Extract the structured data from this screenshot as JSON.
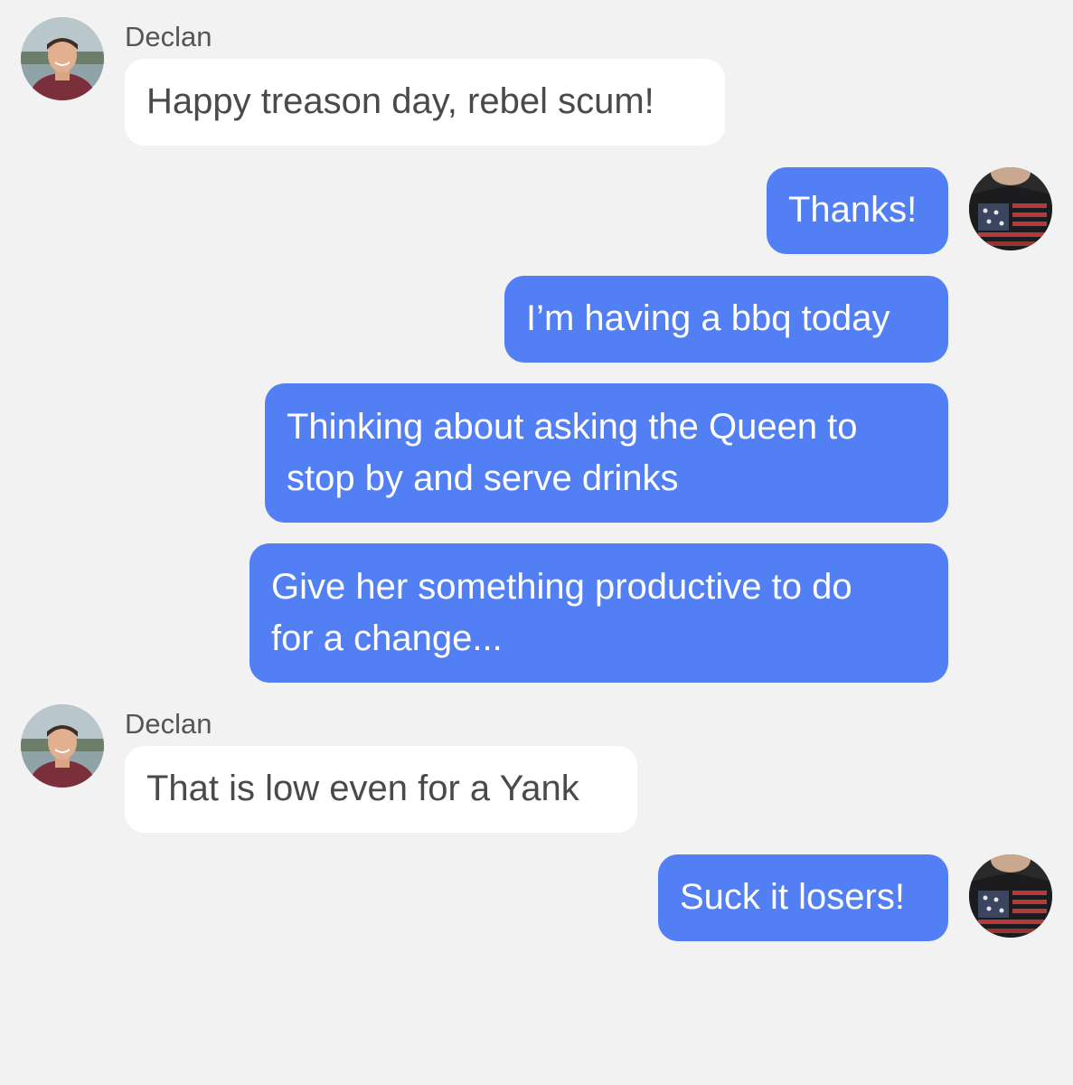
{
  "contact": {
    "name": "Declan",
    "avatar_icon": "person-photo-avatar-icon"
  },
  "me": {
    "avatar_icon": "flag-jacket-avatar-icon"
  },
  "colors": {
    "background": "#f2f2f2",
    "incoming_bubble": "#ffffff",
    "outgoing_bubble": "#527ff3",
    "incoming_text": "#4a4a4a",
    "outgoing_text": "#ffffff",
    "sender_name": "#555555"
  },
  "messages": [
    {
      "direction": "incoming",
      "sender": "Declan",
      "lines": [
        "Happy treason day, rebel scum!"
      ]
    },
    {
      "direction": "outgoing",
      "lines": [
        "Thanks!"
      ]
    },
    {
      "direction": "outgoing",
      "lines": [
        "I’m having a bbq today"
      ]
    },
    {
      "direction": "outgoing",
      "lines": [
        "Thinking about asking the Queen to",
        "stop by and serve drinks"
      ]
    },
    {
      "direction": "outgoing",
      "lines": [
        "Give her something productive to do",
        "for a change..."
      ]
    },
    {
      "direction": "incoming",
      "sender": "Declan",
      "lines": [
        "That is low even for a Yank"
      ]
    },
    {
      "direction": "outgoing",
      "lines": [
        "Suck it losers!"
      ]
    }
  ]
}
